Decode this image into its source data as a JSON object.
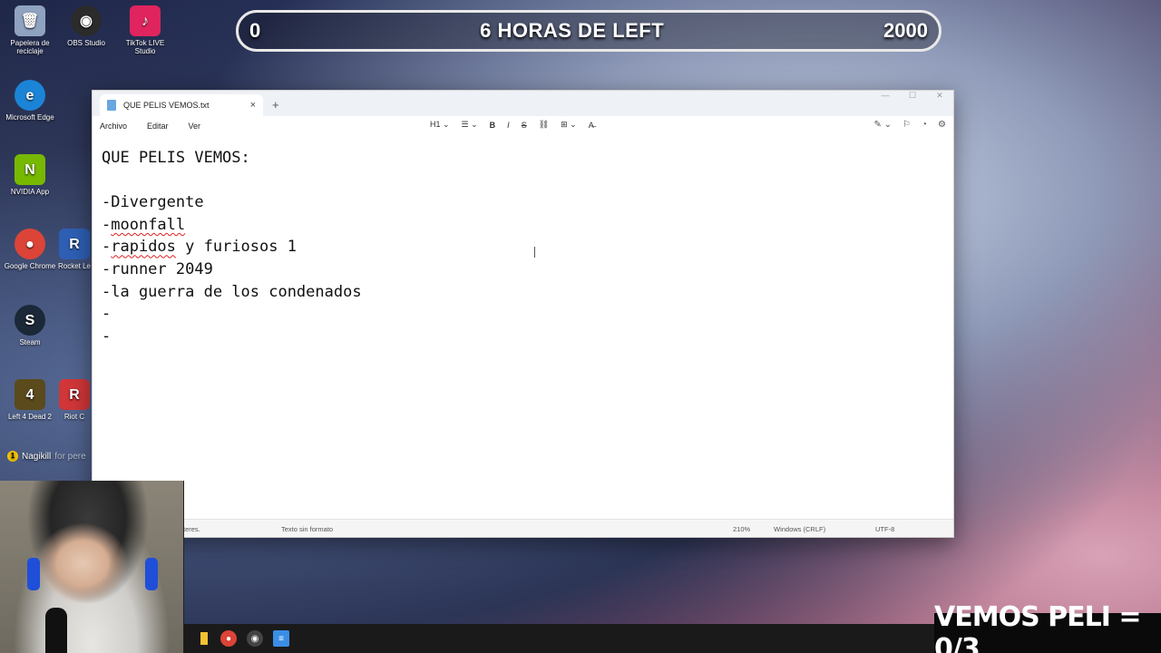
{
  "desktop": {
    "icons": [
      {
        "label": "Papelera de reciclaje",
        "glyph": "🗑",
        "color": "#8fa3c0"
      },
      {
        "label": "OBS Studio",
        "glyph": "◉",
        "color": "#2b2b2b"
      },
      {
        "label": "TikTok LIVE Studio",
        "glyph": "♪",
        "color": "#e0245e"
      },
      {
        "label": "Microsoft Edge",
        "glyph": "e",
        "color": "#1b84d6"
      },
      {
        "label": "NVIDIA App",
        "glyph": "N",
        "color": "#76b900"
      },
      {
        "label": "Google Chrome",
        "glyph": "●",
        "color": "#db4437"
      },
      {
        "label": "Rocket Le",
        "glyph": "R",
        "color": "#2e5fb5"
      },
      {
        "label": "Steam",
        "glyph": "S",
        "color": "#1b2838"
      },
      {
        "label": "Left 4 Dead 2",
        "glyph": "4",
        "color": "#5a4a1c"
      },
      {
        "label": "Riot C",
        "glyph": "R",
        "color": "#d13639"
      }
    ]
  },
  "overlay": {
    "left_value": "0",
    "title": "6 HORAS DE LEFT",
    "right_value": "2000"
  },
  "notepad": {
    "tab_title": "QUE PELIS VEMOS.txt",
    "tab_close": "×",
    "new_tab": "+",
    "window_controls": {
      "minimize": "—",
      "maximize": "☐",
      "close": "✕"
    },
    "menu": {
      "file": "Archivo",
      "edit": "Editar",
      "view": "Ver"
    },
    "toolbar": {
      "heading": "H1 ⌄",
      "list": "☰ ⌄",
      "bold": "B",
      "italic": "I",
      "strike": "S",
      "link": "⛓",
      "table": "⊞ ⌄",
      "clear": "A̶"
    },
    "toolbar_right": {
      "copilot": "✎ ⌄",
      "feedback": "⚐",
      "account": "◔",
      "settings": "⚙"
    },
    "lines": [
      "QUE PELIS VEMOS:",
      "",
      "-Divergente",
      "-moonfall",
      "-rapidos y furiosos 1",
      "-runner 2049",
      "-la guerra de los condenados",
      "-",
      "-"
    ],
    "status": {
      "chars": "teres.",
      "format": "Texto sin formato",
      "zoom": "210%",
      "line_ending": "Windows (CRLF)",
      "encoding": "UTF-8"
    }
  },
  "chat": {
    "badge": "1",
    "user": "Nagikill",
    "message": "for pere"
  },
  "vemos_banner": "VEMOS PELI = 0/3"
}
